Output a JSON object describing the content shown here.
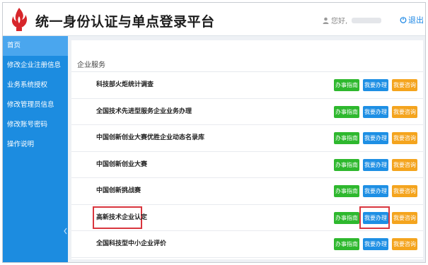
{
  "header": {
    "title": "统一身份认证与单点登录平台",
    "user_label": "您好,",
    "logout_label": "退出",
    "accent_color": "#1c8ce0"
  },
  "sidebar": {
    "items": [
      {
        "label": "首页",
        "active": true
      },
      {
        "label": "修改企业注册信息",
        "active": false
      },
      {
        "label": "业务系统授权",
        "active": false
      },
      {
        "label": "修改管理员信息",
        "active": false
      },
      {
        "label": "修改账号密码",
        "active": false
      },
      {
        "label": "操作说明",
        "active": false
      }
    ]
  },
  "main": {
    "section_title": "企业服务",
    "buttons": {
      "guide": "办事指南",
      "handle": "我要办理",
      "consult": "我要咨询"
    },
    "services": [
      {
        "name": "科技部火炬统计调查",
        "highlighted": false
      },
      {
        "name": "全国技术先进型服务企业业务办理",
        "highlighted": false
      },
      {
        "name": "中国创新创业大赛优胜企业动态名录库",
        "highlighted": false
      },
      {
        "name": "中国创新创业大赛",
        "highlighted": false
      },
      {
        "name": "中国创新挑战赛",
        "highlighted": false
      },
      {
        "name": "高新技术企业认定",
        "highlighted": true
      },
      {
        "name": "全国科技型中小企业评价",
        "highlighted": false
      }
    ],
    "colors": {
      "guide": "#2eb82e",
      "handle": "#1e8fe4",
      "consult": "#f4a41e",
      "highlight": "#d9363e"
    }
  }
}
